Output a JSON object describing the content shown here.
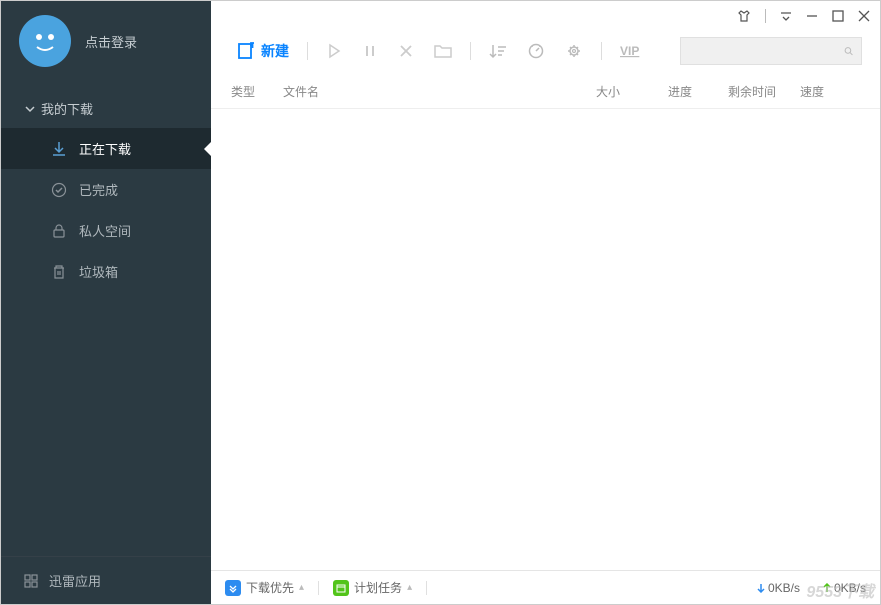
{
  "sidebar": {
    "login_label": "点击登录",
    "section_header": "我的下载",
    "items": [
      {
        "label": "正在下载"
      },
      {
        "label": "已完成"
      },
      {
        "label": "私人空间"
      },
      {
        "label": "垃圾箱"
      }
    ],
    "footer_label": "迅雷应用"
  },
  "toolbar": {
    "new_label": "新建"
  },
  "columns": {
    "type": "类型",
    "filename": "文件名",
    "size": "大小",
    "progress": "进度",
    "remaining": "剩余时间",
    "speed": "速度"
  },
  "search": {
    "placeholder": ""
  },
  "statusbar": {
    "download_priority": "下载优先",
    "scheduled_tasks": "计划任务",
    "down_speed": "0KB/s",
    "up_speed": "0KB/s"
  },
  "watermark": "9553下载"
}
